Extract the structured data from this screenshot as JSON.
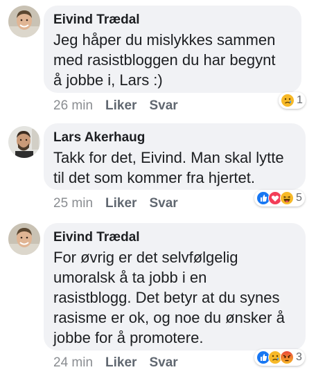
{
  "comments": [
    {
      "author": "Eivind Trædal",
      "text": "Jeg håper du mislykkes sammen\nmed rasistbloggen du har begynt\nå jobbe i, Lars :)",
      "time": "26 min",
      "like": "Liker",
      "reply": "Svar",
      "reaction_count": "1",
      "reactions": [
        "sad"
      ]
    },
    {
      "author": "Lars Akerhaug",
      "text": "Takk for det, Eivind. Man skal lytte\ntil det som kommer fra hjertet.",
      "time": "25 min",
      "like": "Liker",
      "reply": "Svar",
      "reaction_count": "5",
      "reactions": [
        "like",
        "love",
        "haha"
      ]
    },
    {
      "author": "Eivind Trædal",
      "text": "For øvrig er det selvfølgelig\numoralsk å ta jobb i en\nrasistblogg. Det betyr at du synes\nrasisme er ok, og noe du ønsker å\njobbe for å promotere.",
      "time": "24 min",
      "like": "Liker",
      "reply": "Svar",
      "reaction_count": "3",
      "reactions": [
        "like",
        "sad",
        "angry"
      ]
    }
  ],
  "colors": {
    "bubble": "#f1f2f5",
    "like": "#1877f2",
    "love": "#f33e58",
    "haha": "#f7b928",
    "sad": "#f7b928",
    "angry": "#e9710f"
  }
}
